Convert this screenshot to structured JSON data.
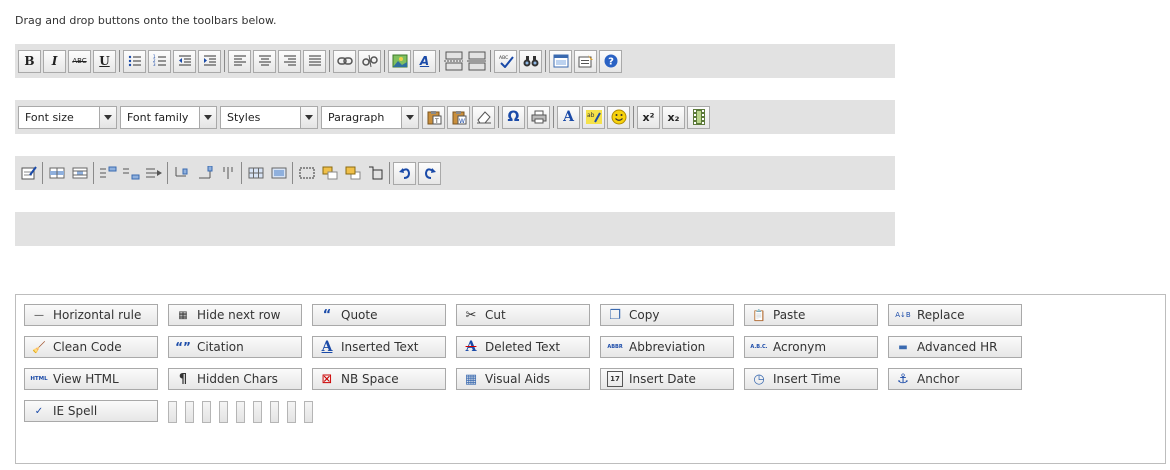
{
  "instruction": "Drag and drop buttons onto the toolbars below.",
  "toolbar2": {
    "font_size": "Font size",
    "font_family": "Font family",
    "styles": "Styles",
    "paragraph": "Paragraph"
  },
  "toolbar_buttons": {
    "bold": "B",
    "italic": "I",
    "strike": "ABC",
    "underline": "U",
    "omega": "Ω",
    "forecolor": "A",
    "superscript": "x²",
    "subscript": "x₂"
  },
  "palette": {
    "items": [
      {
        "label": "Horizontal rule",
        "icon": "—"
      },
      {
        "label": "Hide next row",
        "icon": "▦"
      },
      {
        "label": "Quote",
        "icon": "“"
      },
      {
        "label": "Cut",
        "icon": "✂"
      },
      {
        "label": "Copy",
        "icon": "❐"
      },
      {
        "label": "Paste",
        "icon": "📋"
      },
      {
        "label": "Replace",
        "icon": "A↓B"
      },
      {
        "label": "Clean Code",
        "icon": "🧹"
      },
      {
        "label": "Citation",
        "icon": "“”"
      },
      {
        "label": "Inserted Text",
        "icon": "A"
      },
      {
        "label": "Deleted Text",
        "icon": "A"
      },
      {
        "label": "Abbreviation",
        "icon": "ABBR"
      },
      {
        "label": "Acronym",
        "icon": "A.B.C."
      },
      {
        "label": "Advanced HR",
        "icon": "▬"
      },
      {
        "label": "View HTML",
        "icon": "HTML"
      },
      {
        "label": "Hidden Chars",
        "icon": "¶"
      },
      {
        "label": "NB Space",
        "icon": "⊠"
      },
      {
        "label": "Visual Aids",
        "icon": "▦"
      },
      {
        "label": "Insert Date",
        "icon": "17"
      },
      {
        "label": "Insert Time",
        "icon": "◷"
      },
      {
        "label": "Anchor",
        "icon": "⚓"
      },
      {
        "label": "IE Spell",
        "icon": "✓"
      }
    ]
  }
}
